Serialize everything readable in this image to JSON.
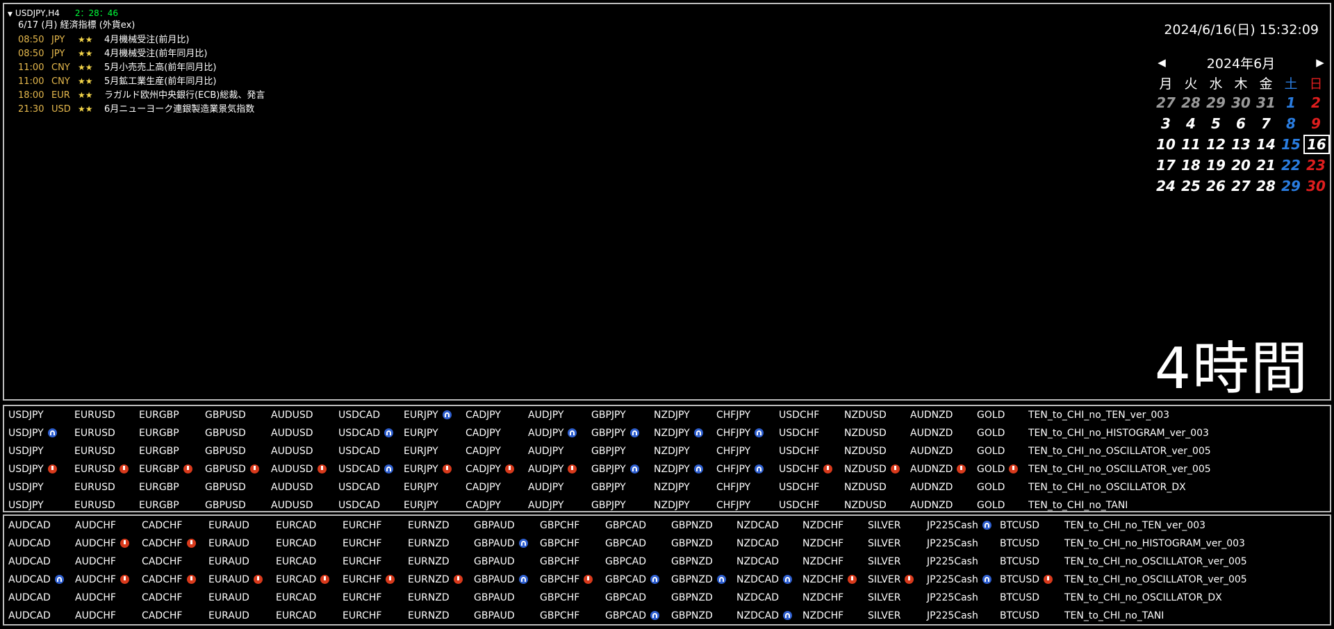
{
  "chart": {
    "symbol": "USDJPY,H4",
    "countdown": "2：28：46",
    "datetime": "2024/6/16(日) 15:32:09",
    "timeframe_label": "4時間",
    "news_title": "6/17 (月) 経済指標 (外貨ex)",
    "news": [
      {
        "time": "08:50",
        "currency": "JPY",
        "stars": "★★",
        "event": "4月機械受注(前月比)"
      },
      {
        "time": "08:50",
        "currency": "JPY",
        "stars": "★★",
        "event": "4月機械受注(前年同月比)"
      },
      {
        "time": "11:00",
        "currency": "CNY",
        "stars": "★★",
        "event": "5月小売売上高(前年同月比)"
      },
      {
        "time": "11:00",
        "currency": "CNY",
        "stars": "★★",
        "event": "5月鉱工業生産(前年同月比)"
      },
      {
        "time": "18:00",
        "currency": "EUR",
        "stars": "★★",
        "event": "ラガルド欧州中央銀行(ECB)総裁、発言"
      },
      {
        "time": "21:30",
        "currency": "USD",
        "stars": "★★",
        "event": "6月ニューヨーク連銀製造業景気指数"
      }
    ]
  },
  "calendar": {
    "month_label": "2024年6月",
    "prev_label": "◀",
    "next_label": "▶",
    "weekdays": [
      "月",
      "火",
      "水",
      "木",
      "金",
      "土",
      "日"
    ],
    "weeks": [
      [
        "27",
        "28",
        "29",
        "30",
        "31",
        "1",
        "2"
      ],
      [
        "3",
        "4",
        "5",
        "6",
        "7",
        "8",
        "9"
      ],
      [
        "10",
        "11",
        "12",
        "13",
        "14",
        "15",
        "16"
      ],
      [
        "17",
        "18",
        "19",
        "20",
        "21",
        "22",
        "23"
      ],
      [
        "24",
        "25",
        "26",
        "27",
        "28",
        "29",
        "30"
      ]
    ],
    "today": "16",
    "colors": {
      "saturday": "#2a7de1",
      "sunday": "#e01e1e",
      "other_month": "#9a9a9a"
    }
  },
  "grid1": {
    "symbols": [
      "USDJPY",
      "EURUSD",
      "EURGBP",
      "GBPUSD",
      "AUDUSD",
      "USDCAD",
      "EURJPY",
      "CADJPY",
      "AUDJPY",
      "GBPJPY",
      "NZDJPY",
      "CHFJPY",
      "USDCHF",
      "NZDUSD",
      "AUDNZD",
      "GOLD"
    ],
    "rows": [
      {
        "indicator": "TEN_to_CHI_no_TEN_ver_003",
        "signals": [
          "",
          "",
          "",
          "",
          "",
          "",
          "blue",
          "",
          "",
          "",
          "",
          "",
          "",
          "",
          "",
          ""
        ]
      },
      {
        "indicator": "TEN_to_CHI_no_HISTOGRAM_ver_003",
        "signals": [
          "blue",
          "",
          "",
          "",
          "",
          "blue",
          "",
          "",
          "blue",
          "blue",
          "blue",
          "blue",
          "",
          "",
          "",
          ""
        ]
      },
      {
        "indicator": "TEN_to_CHI_no_OSCILLATOR_ver_005",
        "signals": [
          "",
          "",
          "",
          "",
          "",
          "",
          "",
          "",
          "",
          "",
          "",
          "",
          "",
          "",
          "",
          ""
        ]
      },
      {
        "indicator": "TEN_to_CHI_no_OSCILLATOR_ver_005",
        "signals": [
          "red",
          "red",
          "red",
          "red",
          "red",
          "blue",
          "red",
          "red",
          "red",
          "blue",
          "blue",
          "blue",
          "red",
          "red",
          "red",
          "red"
        ]
      },
      {
        "indicator": "TEN_to_CHI_no_OSCILLATOR_DX",
        "signals": [
          "",
          "",
          "",
          "",
          "",
          "",
          "",
          "",
          "",
          "",
          "",
          "",
          "",
          "",
          "",
          ""
        ]
      },
      {
        "indicator": "TEN_to_CHI_no_TANI",
        "signals": [
          "",
          "",
          "",
          "",
          "",
          "",
          "",
          "",
          "",
          "",
          "",
          "",
          "",
          "",
          "",
          ""
        ]
      }
    ]
  },
  "grid2": {
    "symbols": [
      "AUDCAD",
      "AUDCHF",
      "CADCHF",
      "EURAUD",
      "EURCAD",
      "EURCHF",
      "EURNZD",
      "GBPAUD",
      "GBPCHF",
      "GBPCAD",
      "GBPNZD",
      "NZDCAD",
      "NZDCHF",
      "SILVER",
      "JP225Cash",
      "BTCUSD"
    ],
    "rows": [
      {
        "indicator": "TEN_to_CHI_no_TEN_ver_003",
        "signals": [
          "",
          "",
          "",
          "",
          "",
          "",
          "",
          "",
          "",
          "",
          "",
          "",
          "",
          "",
          "blue",
          ""
        ]
      },
      {
        "indicator": "TEN_to_CHI_no_HISTOGRAM_ver_003",
        "signals": [
          "",
          "red",
          "red",
          "",
          "",
          "",
          "",
          "blue",
          "",
          "",
          "",
          "",
          "",
          "",
          "",
          ""
        ]
      },
      {
        "indicator": "TEN_to_CHI_no_OSCILLATOR_ver_005",
        "signals": [
          "",
          "",
          "",
          "",
          "",
          "",
          "",
          "",
          "",
          "",
          "",
          "",
          "",
          "",
          "",
          ""
        ]
      },
      {
        "indicator": "TEN_to_CHI_no_OSCILLATOR_ver_005",
        "signals": [
          "blue",
          "red",
          "red",
          "red",
          "red",
          "red",
          "red",
          "blue",
          "red",
          "blue",
          "blue",
          "blue",
          "red",
          "red",
          "blue",
          "red"
        ]
      },
      {
        "indicator": "TEN_to_CHI_no_OSCILLATOR_DX",
        "signals": [
          "",
          "",
          "",
          "",
          "",
          "",
          "",
          "",
          "",
          "",
          "",
          "",
          "",
          "",
          "",
          ""
        ]
      },
      {
        "indicator": "TEN_to_CHI_no_TANI",
        "signals": [
          "",
          "",
          "",
          "",
          "",
          "",
          "",
          "",
          "",
          "blue",
          "",
          "blue",
          "",
          "",
          "",
          ""
        ]
      }
    ]
  },
  "colors": {
    "signal_red": "#d83a1c",
    "signal_blue": "#2e5fd0",
    "countdown": "#00ff3a",
    "news_time": "#e6b94d",
    "stars": "#f5d64a"
  }
}
